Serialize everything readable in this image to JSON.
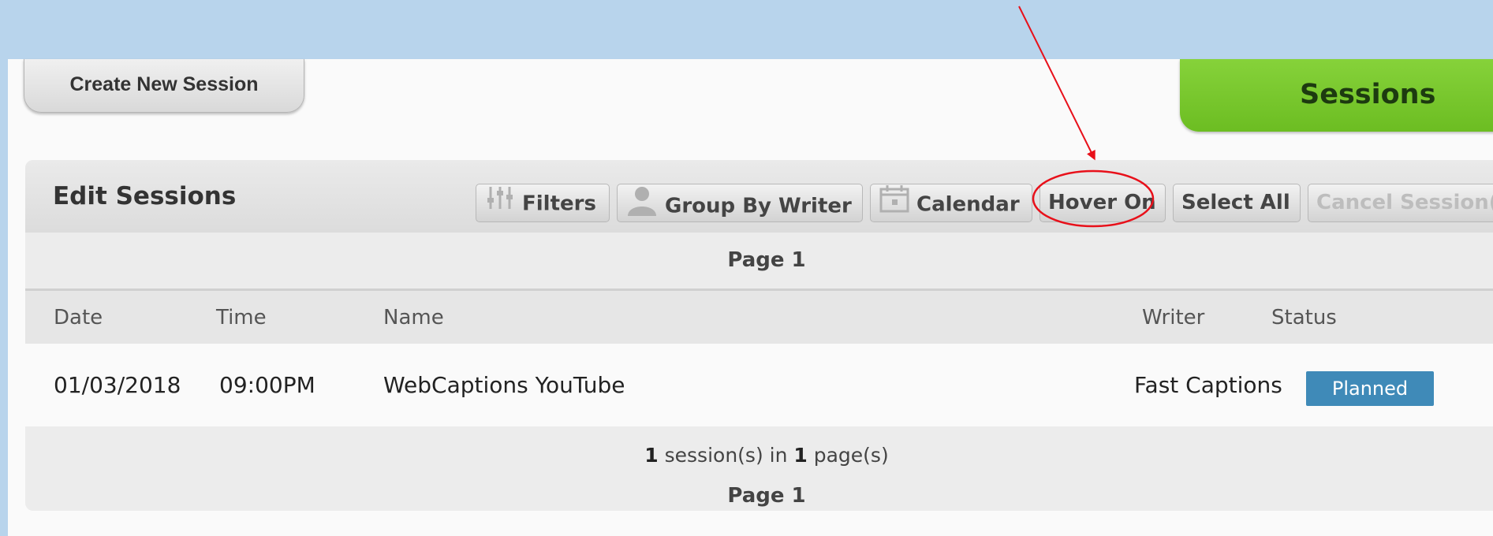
{
  "header": {
    "create_button": "Create New Session",
    "sessions_tab": "Sessions"
  },
  "panel": {
    "title": "Edit Sessions",
    "toolbar": {
      "filters": "Filters",
      "group_by_writer": "Group By Writer",
      "calendar": "Calendar",
      "hover_on": "Hover On",
      "select_all": "Select All",
      "cancel_sessions": "Cancel Session(s"
    },
    "page_label_top": "Page 1",
    "page_label_bottom": "Page 1",
    "columns": {
      "date": "Date",
      "time": "Time",
      "name": "Name",
      "writer": "Writer",
      "status": "Status"
    },
    "rows": [
      {
        "date": "01/03/2018",
        "time": "09:00PM",
        "name": "WebCaptions YouTube",
        "writer": "Fast Captions",
        "status": "Planned"
      }
    ],
    "summary": {
      "count": "1",
      "text1": " session(s) in ",
      "pages": "1",
      "text2": " page(s)"
    }
  },
  "colors": {
    "status_planned": "#3f8ab8",
    "sessions_tab": "#7ccb2f",
    "annotation": "#e8101a"
  }
}
